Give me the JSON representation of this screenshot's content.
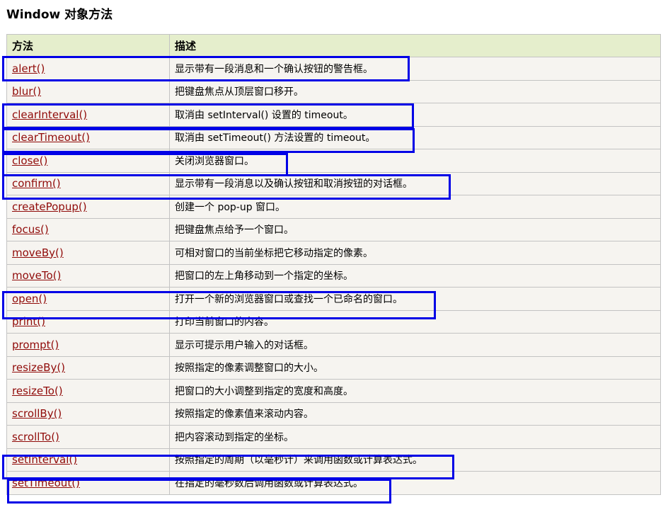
{
  "page": {
    "title": "Window 对象方法"
  },
  "table": {
    "headers": [
      "方法",
      "描述"
    ],
    "rows": [
      {
        "method": "alert()",
        "desc": "显示带有一段消息和一个确认按钮的警告框。"
      },
      {
        "method": "blur()",
        "desc": "把键盘焦点从顶层窗口移开。"
      },
      {
        "method": "clearInterval()",
        "desc": "取消由 setInterval() 设置的 timeout。"
      },
      {
        "method": "clearTimeout()",
        "desc": "取消由 setTimeout() 方法设置的 timeout。"
      },
      {
        "method": "close()",
        "desc": "关闭浏览器窗口。"
      },
      {
        "method": "confirm()",
        "desc": "显示带有一段消息以及确认按钮和取消按钮的对话框。"
      },
      {
        "method": "createPopup()",
        "desc": "创建一个 pop-up 窗口。"
      },
      {
        "method": "focus()",
        "desc": "把键盘焦点给予一个窗口。"
      },
      {
        "method": "moveBy()",
        "desc": "可相对窗口的当前坐标把它移动指定的像素。"
      },
      {
        "method": "moveTo()",
        "desc": "把窗口的左上角移动到一个指定的坐标。"
      },
      {
        "method": "open()",
        "desc": "打开一个新的浏览器窗口或查找一个已命名的窗口。"
      },
      {
        "method": "print()",
        "desc": "打印当前窗口的内容。"
      },
      {
        "method": "prompt()",
        "desc": "显示可提示用户输入的对话框。"
      },
      {
        "method": "resizeBy()",
        "desc": "按照指定的像素调整窗口的大小。"
      },
      {
        "method": "resizeTo()",
        "desc": "把窗口的大小调整到指定的宽度和高度。"
      },
      {
        "method": "scrollBy()",
        "desc": "按照指定的像素值来滚动内容。"
      },
      {
        "method": "scrollTo()",
        "desc": "把内容滚动到指定的坐标。"
      },
      {
        "method": "setInterval()",
        "desc": "按照指定的周期（以毫秒计）来调用函数或计算表达式。"
      },
      {
        "method": "setTimeout()",
        "desc": "在指定的毫秒数后调用函数或计算表达式。"
      }
    ]
  },
  "colors": {
    "link": "#900b09",
    "header_bg": "#e5eecc",
    "row_bg": "#f6f4f0",
    "border": "#c3c3c3",
    "highlight": "#0000e6"
  },
  "highlighted_methods": [
    "alert()",
    "clearInterval()",
    "clearTimeout()",
    "close()",
    "confirm()",
    "open()",
    "setInterval()",
    "setTimeout()"
  ]
}
